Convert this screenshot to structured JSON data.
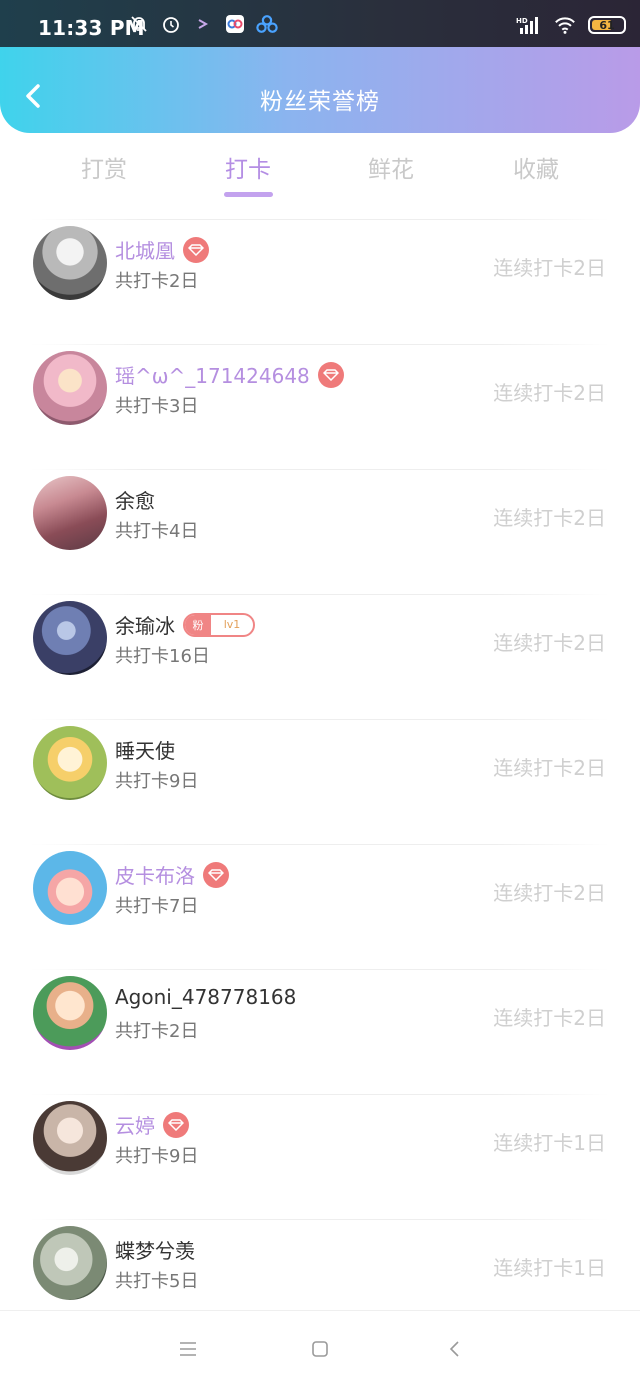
{
  "status_bar": {
    "time": "11:33 PM",
    "battery": "61",
    "icons": [
      "mute-bell-icon",
      "alarm-icon",
      "arrow-icon",
      "app-icon",
      "app-icon",
      "hd-signal-icon",
      "wifi-icon",
      "battery-icon"
    ]
  },
  "header": {
    "title": "粉丝荣誉榜",
    "back_icon": "chevron-left-icon",
    "gradient": [
      "#3fd3ec",
      "#b99be8"
    ]
  },
  "tabs": [
    {
      "label": "打赏",
      "active": false
    },
    {
      "label": "打卡",
      "active": true
    },
    {
      "label": "鲜花",
      "active": false
    },
    {
      "label": "收藏",
      "active": false
    }
  ],
  "colors": {
    "accent": "#b58fe0",
    "badge": "#ef7a7a",
    "muted": "#cfcfcf"
  },
  "list": [
    {
      "name": "北城凰",
      "badge": "gem",
      "total": "共打卡2日",
      "streak": "连续打卡2日"
    },
    {
      "name": "瑶^ω^_171424648",
      "badge": "gem",
      "total": "共打卡3日",
      "streak": "连续打卡2日"
    },
    {
      "name": "余愈",
      "badge": "",
      "total": "共打卡4日",
      "streak": "连续打卡2日"
    },
    {
      "name": "余瑜冰",
      "badge": "fan",
      "fan_label": "粉",
      "fan_level": "lv1",
      "total": "共打卡16日",
      "streak": "连续打卡2日"
    },
    {
      "name": "睡天使",
      "badge": "",
      "total": "共打卡9日",
      "streak": "连续打卡2日"
    },
    {
      "name": "皮卡布洛",
      "badge": "gem",
      "total": "共打卡7日",
      "streak": "连续打卡2日"
    },
    {
      "name": "Agoni_478778168",
      "badge": "",
      "total": "共打卡2日",
      "streak": "连续打卡2日"
    },
    {
      "name": "云婷",
      "badge": "gem",
      "total": "共打卡9日",
      "streak": "连续打卡1日"
    },
    {
      "name": "蝶梦兮羡",
      "badge": "",
      "total": "共打卡5日",
      "streak": "连续打卡1日"
    }
  ],
  "navbar": {
    "icons": [
      "menu-icon",
      "home-square-icon",
      "back-triangle-icon"
    ]
  }
}
